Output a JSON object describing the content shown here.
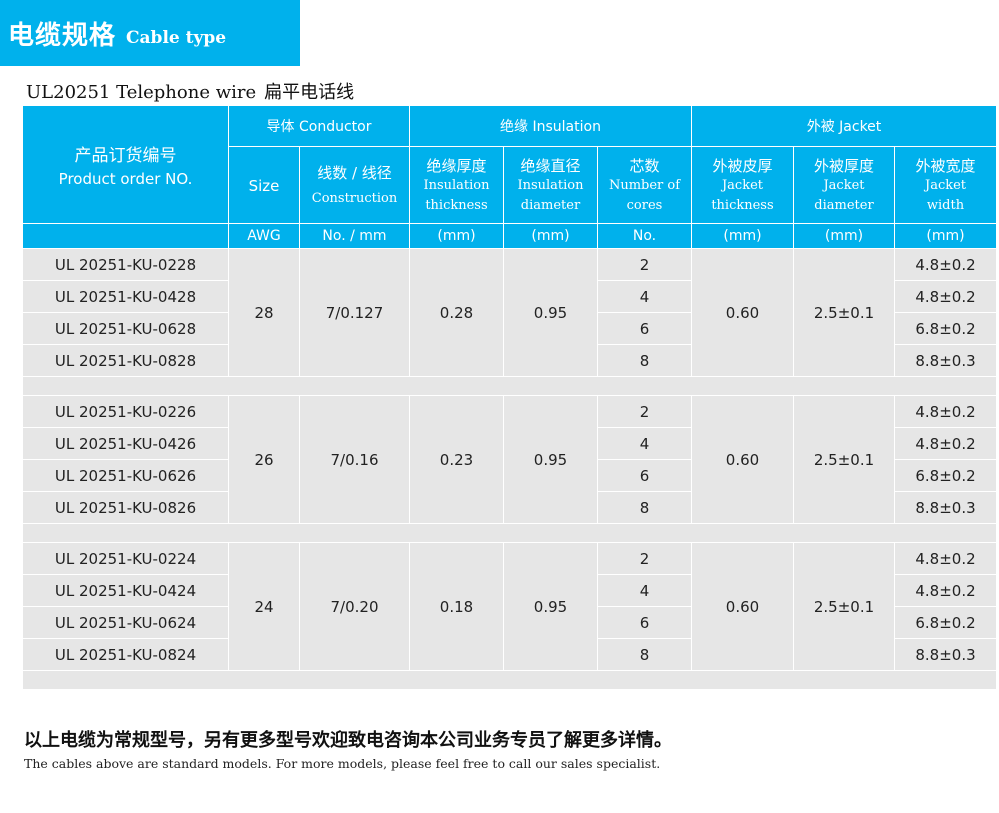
{
  "banner": {
    "title_zh": "电缆规格",
    "title_en": "Cable type"
  },
  "subtitle": {
    "model_en": "UL20251 Telephone wire",
    "model_zh": "扁平电话线"
  },
  "table": {
    "product_header_zh": "产品订货编号",
    "product_header_en": "Product order NO.",
    "groups": {
      "conductor": "导体 Conductor",
      "insulation": "绝缘  Insulation",
      "jacket": "外被  Jacket"
    },
    "cols": {
      "size": "Size",
      "construction_zh": "线数 / 线径",
      "construction_en": "Construction",
      "ins_thk_zh": "绝缘厚度",
      "ins_thk_en1": "Insulation",
      "ins_thk_en2": "thickness",
      "ins_dia_zh": "绝缘直径",
      "ins_dia_en1": "Insulation",
      "ins_dia_en2": "diameter",
      "cores_zh": "芯数",
      "cores_en1": "Number of",
      "cores_en2": "cores",
      "jk_thk_zh": "外被皮厚",
      "jk_thk_en1": "Jacket",
      "jk_thk_en2": "thickness",
      "jk_dia_zh": "外被厚度",
      "jk_dia_en1": "Jacket",
      "jk_dia_en2": "diameter",
      "jk_w_zh": "外被宽度",
      "jk_w_en1": "Jacket",
      "jk_w_en2": "width"
    },
    "units": [
      "AWG",
      "No. / mm",
      "(mm)",
      "(mm)",
      "No.",
      "(mm)",
      "(mm)",
      "(mm)"
    ],
    "groups_data": [
      {
        "awg": "28",
        "construction": "7/0.127",
        "ins_thk": "0.28",
        "ins_dia": "0.95",
        "jk_thk": "0.60",
        "jk_dia": "2.5±0.1",
        "rows": [
          {
            "code": "UL 20251-KU-0228",
            "cores": "2",
            "width": "4.8±0.2"
          },
          {
            "code": "UL 20251-KU-0428",
            "cores": "4",
            "width": "4.8±0.2"
          },
          {
            "code": "UL 20251-KU-0628",
            "cores": "6",
            "width": "6.8±0.2"
          },
          {
            "code": "UL 20251-KU-0828",
            "cores": "8",
            "width": "8.8±0.3"
          }
        ]
      },
      {
        "awg": "26",
        "construction": "7/0.16",
        "ins_thk": "0.23",
        "ins_dia": "0.95",
        "jk_thk": "0.60",
        "jk_dia": "2.5±0.1",
        "rows": [
          {
            "code": "UL 20251-KU-0226",
            "cores": "2",
            "width": "4.8±0.2"
          },
          {
            "code": "UL 20251-KU-0426",
            "cores": "4",
            "width": "4.8±0.2"
          },
          {
            "code": "UL 20251-KU-0626",
            "cores": "6",
            "width": "6.8±0.2"
          },
          {
            "code": "UL 20251-KU-0826",
            "cores": "8",
            "width": "8.8±0.3"
          }
        ]
      },
      {
        "awg": "24",
        "construction": "7/0.20",
        "ins_thk": "0.18",
        "ins_dia": "0.95",
        "jk_thk": "0.60",
        "jk_dia": "2.5±0.1",
        "rows": [
          {
            "code": "UL 20251-KU-0224",
            "cores": "2",
            "width": "4.8±0.2"
          },
          {
            "code": "UL 20251-KU-0424",
            "cores": "4",
            "width": "4.8±0.2"
          },
          {
            "code": "UL 20251-KU-0624",
            "cores": "6",
            "width": "6.8±0.2"
          },
          {
            "code": "UL 20251-KU-0824",
            "cores": "8",
            "width": "8.8±0.3"
          }
        ]
      }
    ]
  },
  "notes": {
    "zh": "以上电缆为常规型号，另有更多型号欢迎致电咨询本公司业务专员了解更多详情。",
    "en": "The cables above are standard models. For more models, please feel free to call our sales specialist."
  },
  "colors": {
    "header": "#00b1ec",
    "row_bg": "#e6e6e6"
  }
}
